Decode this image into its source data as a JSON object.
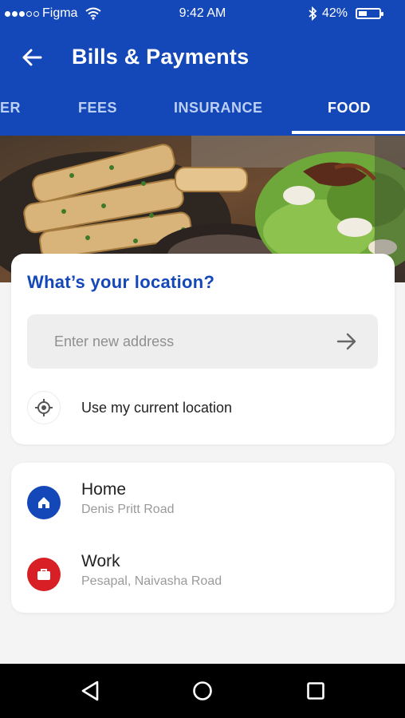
{
  "status_bar": {
    "carrier": "Figma",
    "time": "9:42 AM",
    "battery_text": "42%",
    "battery_level": 0.42
  },
  "app_bar": {
    "title": "Bills & Payments",
    "back_icon": "arrow-left-icon"
  },
  "tabs": [
    {
      "label": "ER",
      "active": false
    },
    {
      "label": "FEES",
      "active": false
    },
    {
      "label": "INSURANCE",
      "active": false
    },
    {
      "label": "FOOD",
      "active": true
    }
  ],
  "location": {
    "heading": "What’s your location?",
    "address_placeholder": "Enter new address",
    "address_value": "",
    "submit_icon": "arrow-right-icon",
    "current_location_label": "Use my current location",
    "current_location_icon": "gps-target-icon"
  },
  "saved_places": [
    {
      "name": "Home",
      "address": "Denis Pritt Road",
      "icon": "home-icon",
      "color": "#1447b8"
    },
    {
      "name": "Work",
      "address": "Pesapal, Naivasha Road",
      "icon": "briefcase-icon",
      "color": "#d81f26"
    }
  ],
  "colors": {
    "brand": "#1447b8",
    "work": "#d81f26",
    "background": "#f4f4f4"
  },
  "nav_bar": {
    "icons": [
      "back-triangle-icon",
      "home-circle-icon",
      "recents-square-icon"
    ]
  }
}
